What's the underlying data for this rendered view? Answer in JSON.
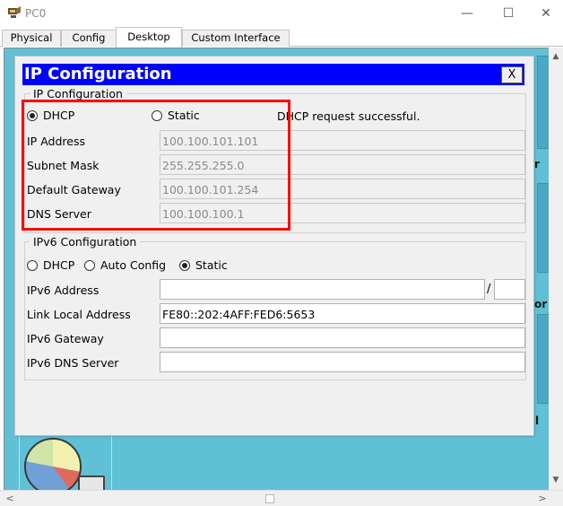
{
  "window": {
    "title": "PC0",
    "icon": "network-device-icon",
    "minimize_glyph": "—",
    "maximize_glyph": "☐",
    "close_glyph": "✕"
  },
  "tabs": [
    {
      "label": "Physical"
    },
    {
      "label": "Config"
    },
    {
      "label": "Desktop",
      "active": true
    },
    {
      "label": "Custom Interface"
    }
  ],
  "desktop": {
    "side_text_1": "r",
    "side_text_2": "or",
    "side_text_3": "l"
  },
  "dialog": {
    "title": "IP Configuration",
    "close_label": "X",
    "ipv4": {
      "legend": "IP Configuration",
      "mode_dhcp": "DHCP",
      "mode_static": "Static",
      "selected_mode": "DHCP",
      "status": "DHCP request successful.",
      "ip_label": "IP Address",
      "ip_value": "100.100.101.101",
      "subnet_label": "Subnet Mask",
      "subnet_value": "255.255.255.0",
      "gateway_label": "Default Gateway",
      "gateway_value": "100.100.101.254",
      "dns_label": "DNS Server",
      "dns_value": "100.100.100.1"
    },
    "ipv6": {
      "legend": "IPv6 Configuration",
      "mode_dhcp": "DHCP",
      "mode_auto": "Auto Config",
      "mode_static": "Static",
      "selected_mode": "Static",
      "address_label": "IPv6 Address",
      "address_value": "",
      "prefix_separator": "/",
      "prefix_value": "",
      "link_local_label": "Link Local Address",
      "link_local_value": "FE80::202:4AFF:FED6:5653",
      "gateway_label": "IPv6 Gateway",
      "gateway_value": "",
      "dns_label": "IPv6 DNS Server",
      "dns_value": ""
    }
  },
  "scrollbar": {
    "left_arrow": "<",
    "right_arrow": ">",
    "up_arrow": "▲",
    "down_arrow": "▼"
  },
  "colors": {
    "dialog_title_bg": "#0000ff",
    "desktop_bg": "#5fc0d6",
    "highlight_border": "#ff0000"
  }
}
